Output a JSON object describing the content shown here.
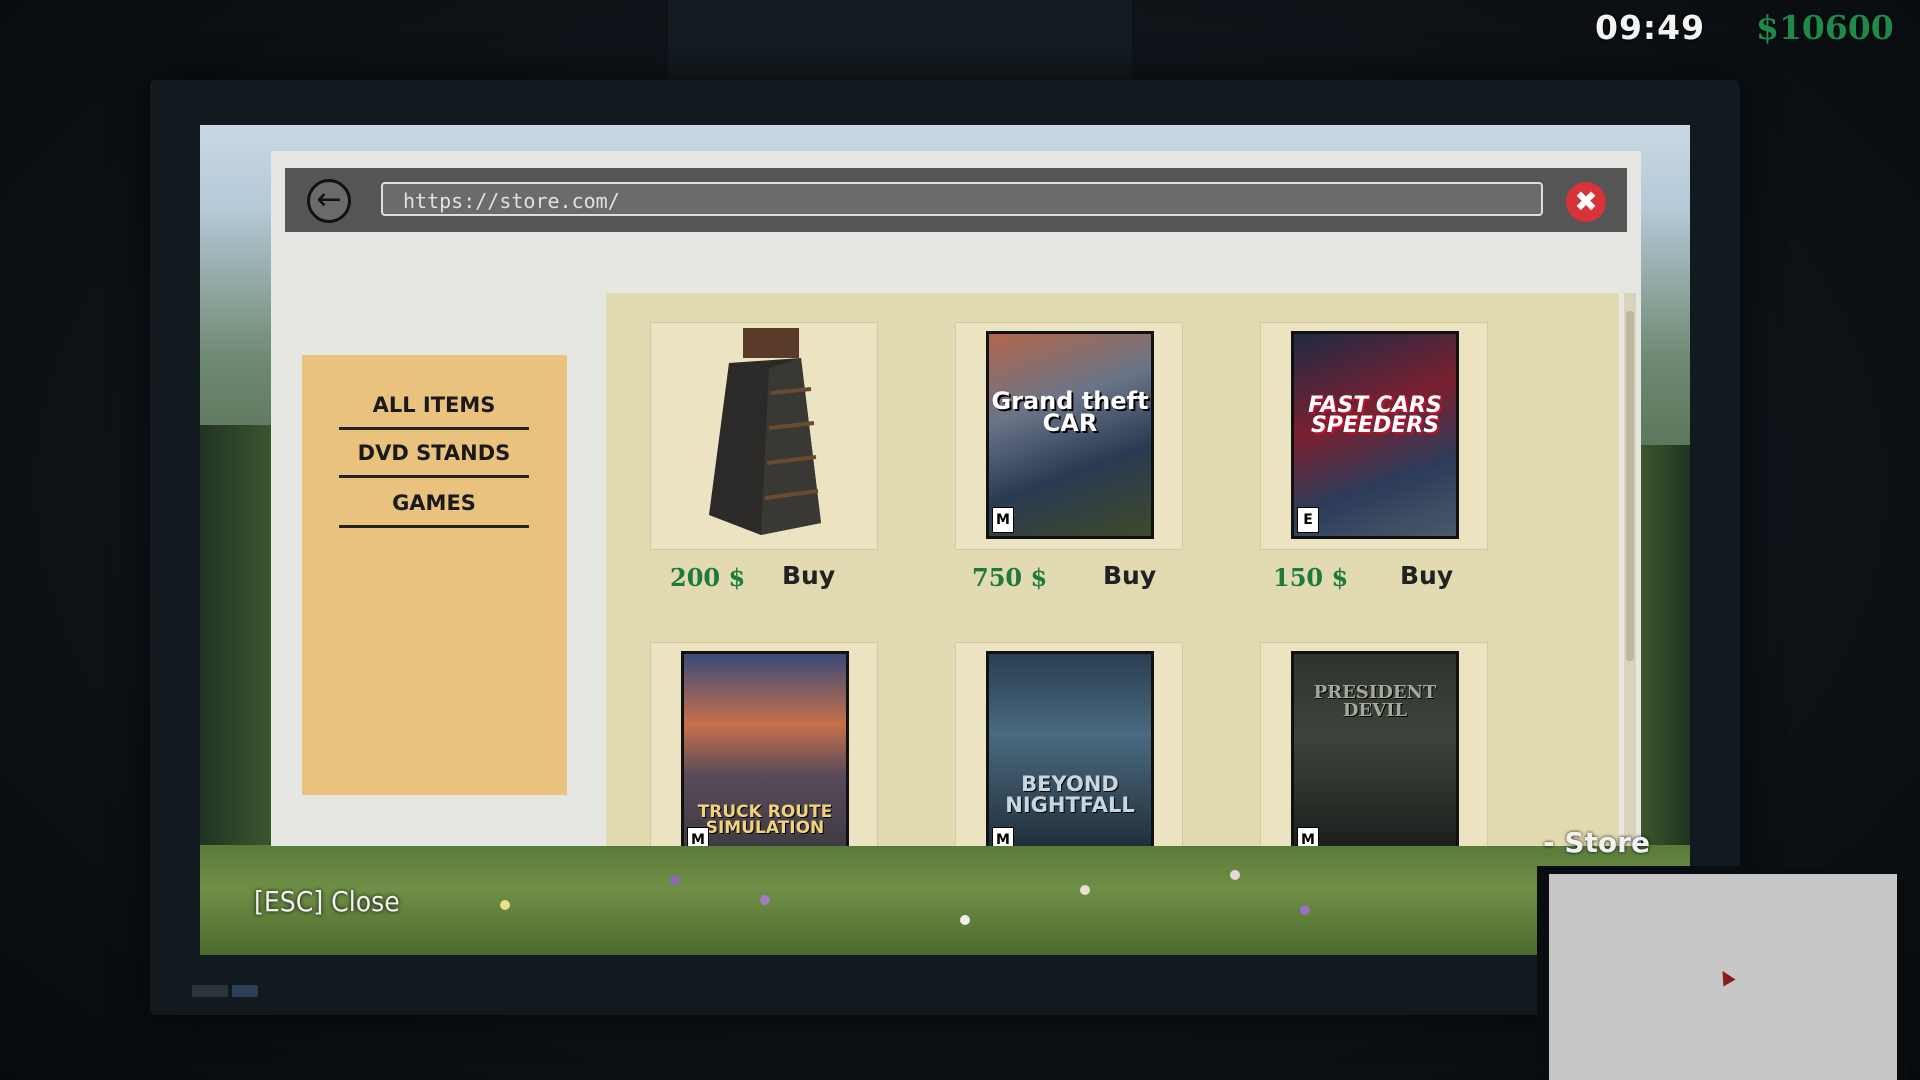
{
  "hud": {
    "time": "09:49",
    "money": "$10600"
  },
  "browser": {
    "url": "https://store.com/",
    "back_icon": "arrow-left-icon",
    "close_icon": "close-icon"
  },
  "sidebar": {
    "items": [
      {
        "label": "ALL ITEMS"
      },
      {
        "label": "DVD STANDS"
      },
      {
        "label": "GAMES"
      }
    ]
  },
  "products": [
    {
      "image": "dvd-stand",
      "price": "200 $",
      "buy": "Buy"
    },
    {
      "image": "grand-theft-car-cover",
      "price": "750 $",
      "buy": "Buy",
      "cover_title": "Grand theft CAR",
      "rating": "M"
    },
    {
      "image": "fast-cars-speeders-cover",
      "price": "150 $",
      "buy": "Buy",
      "cover_title": "FAST CARS SPEEDERS",
      "rating": "E"
    },
    {
      "image": "truck-route-simulation-cover",
      "cover_title": "TRUCK ROUTE SIMULATION",
      "rating": "M"
    },
    {
      "image": "beyond-nightfall-cover",
      "cover_title": "BEYOND NIGHTFALL",
      "rating": "M"
    },
    {
      "image": "president-devil-cover",
      "cover_title": "PRESIDENT DEVIL",
      "rating": "M"
    }
  ],
  "esc_hint": "[ESC] Close",
  "minimap": {
    "label": "- Store"
  },
  "colors": {
    "price": "#1e7a3c",
    "money": "#1e8a4a",
    "sidebar": "#e9c27d",
    "close": "#d9333a"
  }
}
